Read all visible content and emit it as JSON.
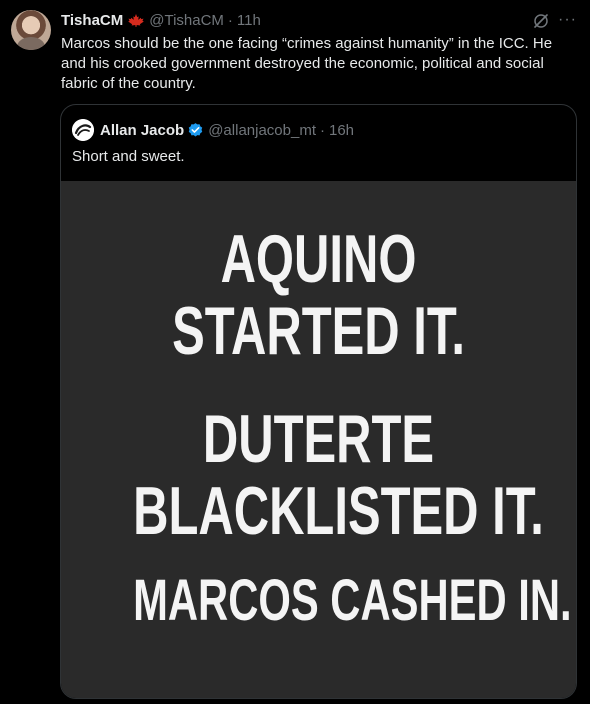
{
  "tweet": {
    "display_name": "TishaCM",
    "flag": "canada-flag-icon",
    "handle": "@TishaCM",
    "dot": "·",
    "time": "11h",
    "text": "Marcos should be the one facing “crimes against humanity” in the ICC. He and his crooked government destroyed the economic, political and social fabric of the country.",
    "more_label": "···",
    "icons": [
      "grok-icon",
      "more-icon",
      "canada-flag-icon",
      "avatar"
    ]
  },
  "quote": {
    "display_name": "Allan Jacob",
    "handle": "@allanjacob_mt",
    "dot": "·",
    "time": "16h",
    "text": "Short and sweet.",
    "verified_color": "#1d9bf0",
    "image": {
      "lines": [
        "AQUINO",
        "STARTED IT.",
        "DUTERTE",
        "BLACKLISTED IT.",
        "MARCOS CASHED IN."
      ],
      "background_color": "#2a2a2a",
      "text_color": "#f4f4f4"
    }
  },
  "colors": {
    "background": "#000000",
    "primary_text": "#e7e9ea",
    "secondary_text": "#71767b",
    "border": "#2f3336",
    "flag_red": "#d52b1e"
  }
}
